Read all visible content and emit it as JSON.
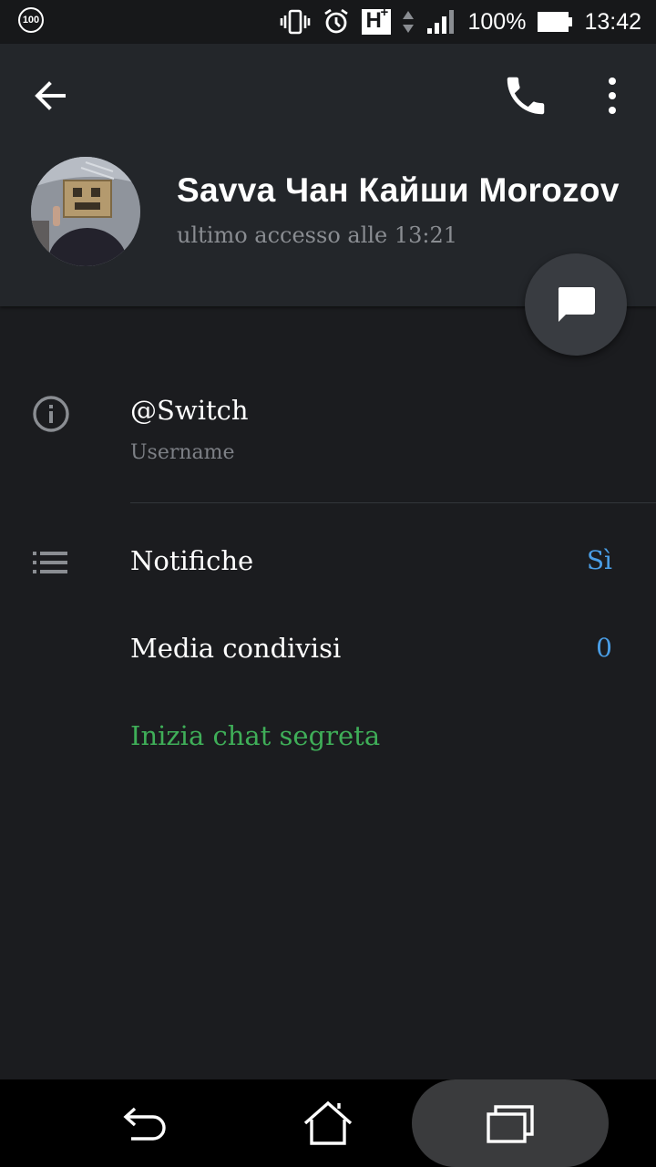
{
  "status_bar": {
    "notification_badge": "100",
    "battery_percent": "100%",
    "time": "13:42",
    "network_type": "H",
    "network_superscript": "+",
    "icons": [
      "vibrate-icon",
      "alarm-icon",
      "network-type-icon",
      "data-arrows-icon",
      "signal-icon",
      "battery-icon"
    ]
  },
  "app_bar": {
    "icons": [
      "back-arrow-icon",
      "phone-icon",
      "more-vert-icon"
    ]
  },
  "profile": {
    "name": "Savva Чан Кайши Morozov",
    "last_seen": "ultimo accesso alle 13:21"
  },
  "info": {
    "username_value": "@Switch",
    "username_label": "Username"
  },
  "settings": {
    "notifications_label": "Notifiche",
    "notifications_value": "Sì",
    "shared_media_label": "Media condivisi",
    "shared_media_value": "0",
    "secret_chat_label": "Inizia chat segreta"
  },
  "colors": {
    "accent_blue": "#4a9ee6",
    "secret_chat_green": "#3fae58",
    "background": "#1b1c1f",
    "header": "#23262a"
  },
  "nav_bar": {
    "icons": [
      "nav-back-icon",
      "nav-home-icon",
      "nav-recents-icon"
    ]
  }
}
